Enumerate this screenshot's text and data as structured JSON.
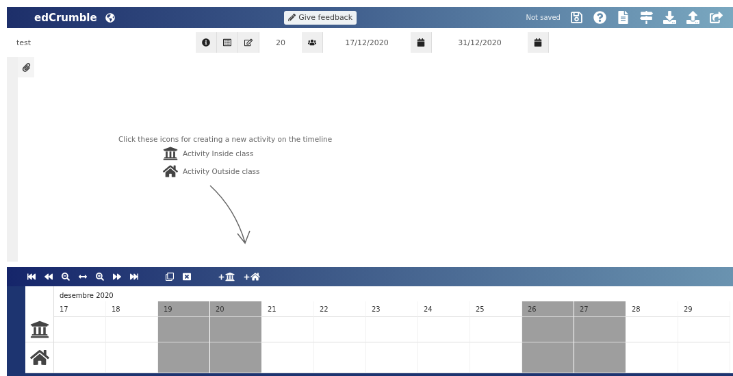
{
  "header": {
    "title": "edCrumble",
    "feedback_button": "Give feedback",
    "status": "Not saved"
  },
  "project": {
    "name": "test",
    "students": "20",
    "start_date": "17/12/2020",
    "end_date": "31/12/2020"
  },
  "hint": {
    "text": "Click these icons for creating a new activity on the timeline",
    "items": [
      {
        "kind": "inside",
        "label": "Activity Inside class"
      },
      {
        "kind": "outside",
        "label": "Activity Outside class"
      }
    ]
  },
  "timeline": {
    "month": "desembre 2020",
    "days": [
      {
        "label": "17",
        "weekend": false
      },
      {
        "label": "18",
        "weekend": false
      },
      {
        "label": "19",
        "weekend": true
      },
      {
        "label": "20",
        "weekend": true
      },
      {
        "label": "21",
        "weekend": false
      },
      {
        "label": "22",
        "weekend": false
      },
      {
        "label": "23",
        "weekend": false
      },
      {
        "label": "24",
        "weekend": false
      },
      {
        "label": "25",
        "weekend": false
      },
      {
        "label": "26",
        "weekend": true
      },
      {
        "label": "27",
        "weekend": true
      },
      {
        "label": "28",
        "weekend": false
      },
      {
        "label": "29",
        "weekend": false
      }
    ],
    "rows": [
      {
        "kind": "inside"
      },
      {
        "kind": "outside"
      }
    ]
  }
}
